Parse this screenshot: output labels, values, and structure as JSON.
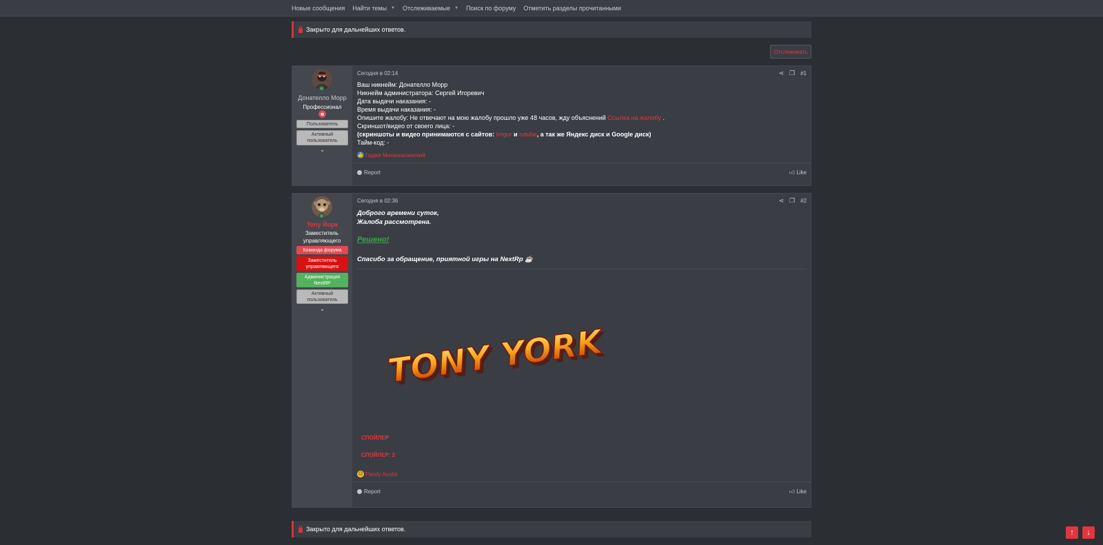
{
  "nav": {
    "items": [
      {
        "label": "Новые сообщения",
        "caret": false
      },
      {
        "label": "Найти темы",
        "caret": true
      },
      {
        "label": "Отслеживаемые",
        "caret": true
      },
      {
        "label": "Поиск по форуму",
        "caret": false
      },
      {
        "label": "Отметить разделы прочитанными",
        "caret": false
      }
    ],
    "caret": "▼"
  },
  "locked_notice": "Закрыто для дальнейших ответов.",
  "watch_button": "Отслеживать",
  "post1": {
    "author": {
      "name": "Донателло Морр",
      "title": "Профессионал",
      "banners": [
        "Пользователь",
        "Активный пользователь"
      ],
      "avatar_icon": "avatar-shield-man",
      "badge_icon": "trophy-icon"
    },
    "date": "Сегодня в 02:14",
    "number": "#1",
    "lines": [
      {
        "text": "Ваш никнейм: Донателло Морр"
      },
      {
        "text": "Никнейм администратора: Сергей Игоревич"
      },
      {
        "text": "Дата выдачи наказания: -"
      },
      {
        "text": "Время выдачи наказания: -"
      },
      {
        "prefix": "Опишите жалобу: Не отвечают на мою жалобу прошло уже 48 часов, жду объяснений ",
        "link": "Ссылка на жалобу",
        "suffix": " ."
      },
      {
        "text": "Скриншот/видео от своего лица: -"
      },
      {
        "prefix": "(скриншоты и видео принимаются с сайтов: ",
        "link": "Imgur",
        "mid": " и ",
        "link2": "rutube",
        "suffix": ", а так же Яндекс диск и Google диск)"
      },
      {
        "text": "Тайм-код: -"
      }
    ],
    "reaction_user": "Гаджи Махачкалинский",
    "reaction_icon": "like-icon",
    "report": "Report",
    "like": "Like"
  },
  "post2": {
    "author": {
      "name": "Tony Йорк",
      "title": "Заместитель управляющего",
      "banners": [
        "Команда форума",
        "Заместитель управляющего",
        "Администрация NextRP",
        "Активный пользователь"
      ],
      "avatar_icon": "avatar-monkey"
    },
    "date": "Сегодня в 02:36",
    "number": "#2",
    "greeting1": "Доброго времени суток,",
    "greeting2": "Жалоба рассмотрена.",
    "resolved": "Решено!",
    "thanks": "Спасибо за обращение, приятной игры на NextRp ☕",
    "signature_image": "TONY YORK",
    "spoiler1": "СПОЙЛЕР",
    "spoiler2": "СПОЙЛЕР: 2",
    "reaction_user": "Pandy Acobir",
    "reaction_icon": "sad-face-icon",
    "report": "Report",
    "like": "Like"
  },
  "colors": {
    "accent": "#e0363f",
    "background": "#2b2e33",
    "panel": "#3a3d43",
    "resolved": "#3da150"
  }
}
